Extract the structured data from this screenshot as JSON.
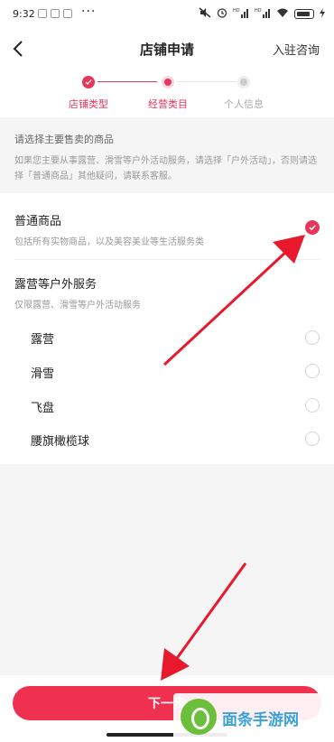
{
  "status_bar": {
    "time": "9:32",
    "dots": "···",
    "hd": "HD",
    "battery": ""
  },
  "header": {
    "title": "店铺申请",
    "consult": "入驻咨询"
  },
  "stepper": {
    "steps": [
      {
        "label": "店铺类型"
      },
      {
        "label": "经营类目"
      },
      {
        "label": "个人信息"
      }
    ]
  },
  "hint": {
    "title": "请选择主要售卖的商品",
    "desc": "如果您主要从事露营、滑雪等户外活动服务，请选择「户外活动」，否则请选择「普通商品」其他疑问，请联系客服。"
  },
  "options": [
    {
      "name": "普通商品",
      "desc": "包括所有实物商品，以及美容美业等生活服务类",
      "checked": true
    },
    {
      "name": "露营等户外服务",
      "desc": "仅限露营、滑雪等户外活动服务",
      "children": [
        {
          "name": "露营"
        },
        {
          "name": "滑雪"
        },
        {
          "name": "飞盘"
        },
        {
          "name": "腰旗橄榄球"
        }
      ]
    }
  ],
  "bottom": {
    "submit_label": "下一步"
  },
  "watermark": {
    "text": "面条手游网"
  },
  "colors": {
    "accent": "#e6375a",
    "button": "#f0304f",
    "arrow": "#e8192c"
  }
}
